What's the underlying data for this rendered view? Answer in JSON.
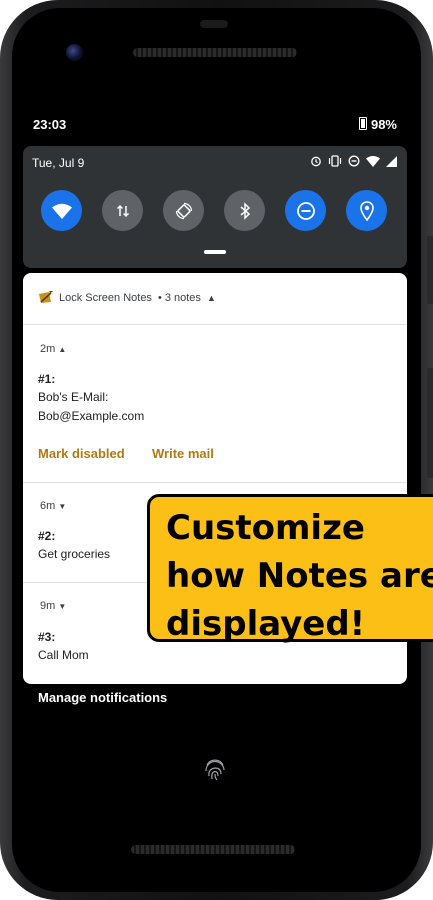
{
  "status_bar": {
    "time": "23:03",
    "battery": "98%"
  },
  "quick_settings": {
    "date": "Tue, Jul 9",
    "tiles": [
      "wifi",
      "mobile-data",
      "auto-rotate",
      "bluetooth",
      "do-not-disturb",
      "location"
    ],
    "accent": "#1a73e8"
  },
  "notification": {
    "app_name": "Lock Screen Notes",
    "summary": "• 3 notes",
    "notes": [
      {
        "age": "2m",
        "title": "#1:",
        "body": "Bob's E-Mail:\nBob@Example.com",
        "expanded": true
      },
      {
        "age": "6m",
        "title": "#2:",
        "body": "Get groceries",
        "expanded": false
      },
      {
        "age": "9m",
        "title": "#3:",
        "body": "Call Mom",
        "expanded": false
      }
    ],
    "actions": {
      "mark_disabled": "Mark disabled",
      "write_mail": "Write mail"
    },
    "action_color": "#b07a12"
  },
  "manage_notifications": "Manage notifications",
  "promo": {
    "line1": "Customize",
    "line2": "how Notes are",
    "line3": "displayed!",
    "background": "#fbbf16"
  }
}
